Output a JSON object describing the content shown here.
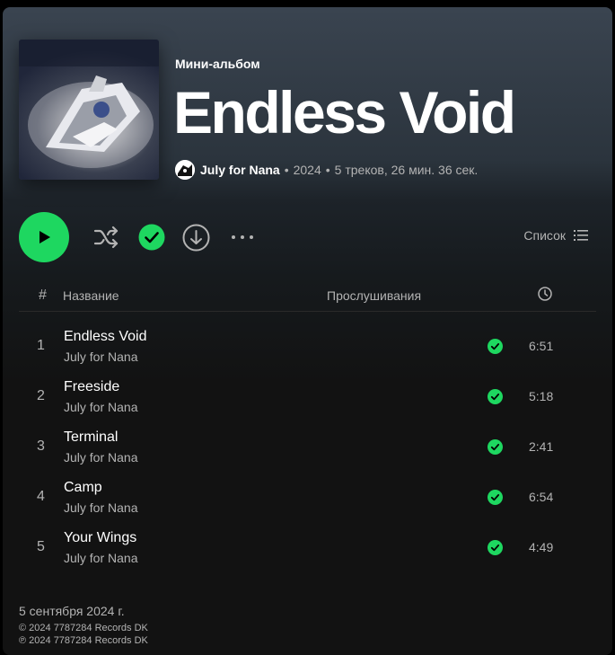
{
  "album": {
    "type_label": "Мини-альбом",
    "title": "Endless Void",
    "artist": "July for Nana",
    "separator": "•",
    "year": "2024",
    "summary": "5 треков, 26 мин. 36 сек."
  },
  "controls": {
    "list_view_label": "Список"
  },
  "table": {
    "col_num": "#",
    "col_title": "Название",
    "col_plays": "Прослушивания"
  },
  "tracks": [
    {
      "num": "1",
      "title": "Endless Void",
      "artist": "July for Nana",
      "duration": "6:51"
    },
    {
      "num": "2",
      "title": "Freeside",
      "artist": "July for Nana",
      "duration": "5:18"
    },
    {
      "num": "3",
      "title": "Terminal",
      "artist": "July for Nana",
      "duration": "2:41"
    },
    {
      "num": "4",
      "title": "Camp",
      "artist": "July for Nana",
      "duration": "6:54"
    },
    {
      "num": "5",
      "title": "Your Wings",
      "artist": "July for Nana",
      "duration": "4:49"
    }
  ],
  "footer": {
    "release_date": "5 сентября 2024 г.",
    "copyright": "© 2024 7787284 Records DK",
    "phonogram": "℗ 2024 7787284 Records DK"
  },
  "colors": {
    "accent": "#1ed760",
    "background": "#121212",
    "header_gradient": "#3a4450",
    "text_secondary": "#b3b3b3"
  }
}
